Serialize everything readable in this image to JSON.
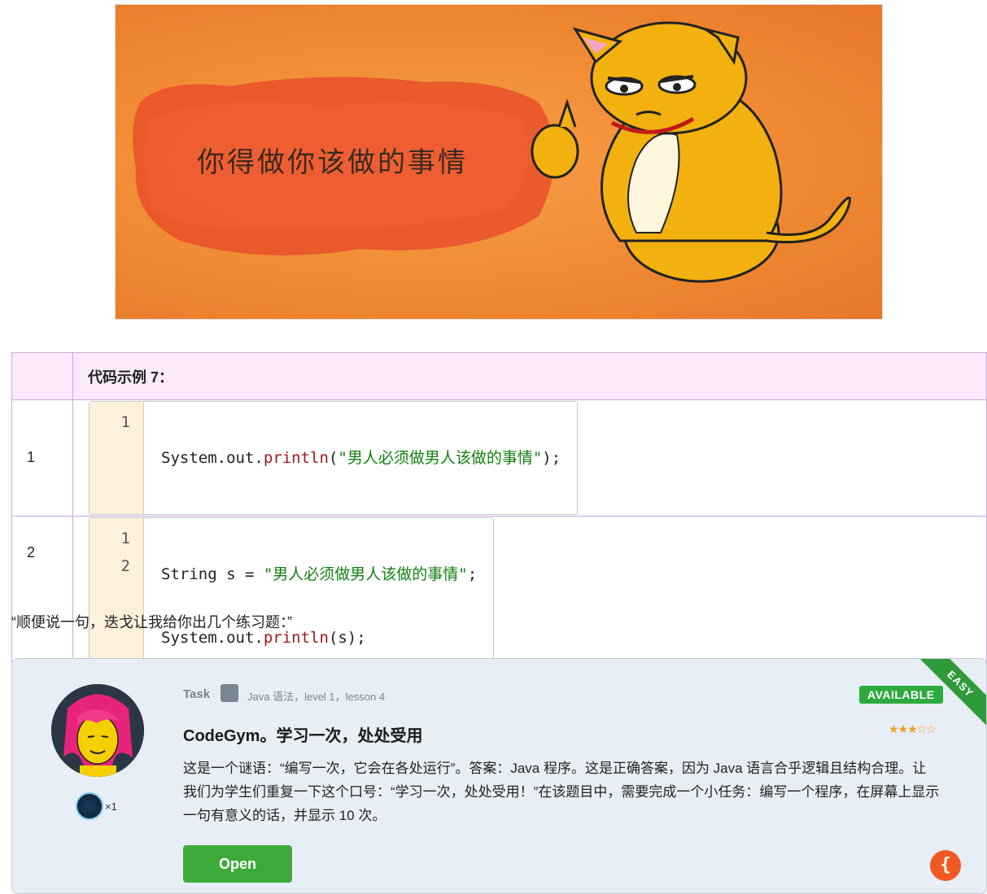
{
  "banner": {
    "caption": "你得做你该做的事情",
    "image": "grumpy-cat-thumbs-up"
  },
  "code_table": {
    "header": "代码示例 7：",
    "rows": [
      {
        "num": "1",
        "lines": [
          {
            "n": "1",
            "parts": [
              {
                "t": "System.out.",
                "c": "plain"
              },
              {
                "t": "println",
                "c": "kw"
              },
              {
                "t": "(",
                "c": "plain"
              },
              {
                "t": "\"男人必须做男人该做的事情\"",
                "c": "str"
              },
              {
                "t": ");",
                "c": "plain"
              }
            ]
          }
        ]
      },
      {
        "num": "2",
        "lines": [
          {
            "n": "1",
            "parts": [
              {
                "t": "String s = ",
                "c": "plain"
              },
              {
                "t": "\"男人必须做男人该做的事情\"",
                "c": "str"
              },
              {
                "t": ";",
                "c": "plain"
              }
            ]
          },
          {
            "n": "2",
            "parts": [
              {
                "t": "System.out.",
                "c": "plain"
              },
              {
                "t": "println",
                "c": "kw"
              },
              {
                "t": "(s);",
                "c": "plain"
              }
            ]
          }
        ]
      }
    ]
  },
  "note": "“顺便说一句，迭戈让我给你出几个练习题：”",
  "task": {
    "label": "Task",
    "breadcrumb": "Java 语法，level 1，lesson 4",
    "status": "AVAILABLE",
    "difficulty": "EASY",
    "title": "CodeGym。学习一次，处处受用",
    "rating_stars": "★★★☆☆",
    "description": "这是一个谜语：“编写一次，它会在各处运行”。答案：Java 程序。这是正确答案，因为 Java 语言合乎逻辑且结构合理。让我们为学生们重复一下这个口号：“学习一次，处处受用！”在该题目中，需要完成一个小任务：编写一个程序，在屏幕上显示一句有意义的话，并显示 10 次。",
    "badge_count": "×1",
    "open_label": "Open",
    "logo_glyph": "{"
  },
  "colors": {
    "banner_orange": "#f08a32",
    "table_border": "#c9a9d9",
    "header_bg": "#f9e9fb",
    "string_green": "#138013",
    "keyword_red": "#a01919",
    "available_green": "#2eaa3d",
    "open_green": "#3faa3c",
    "card_bg": "#e8eef5"
  }
}
